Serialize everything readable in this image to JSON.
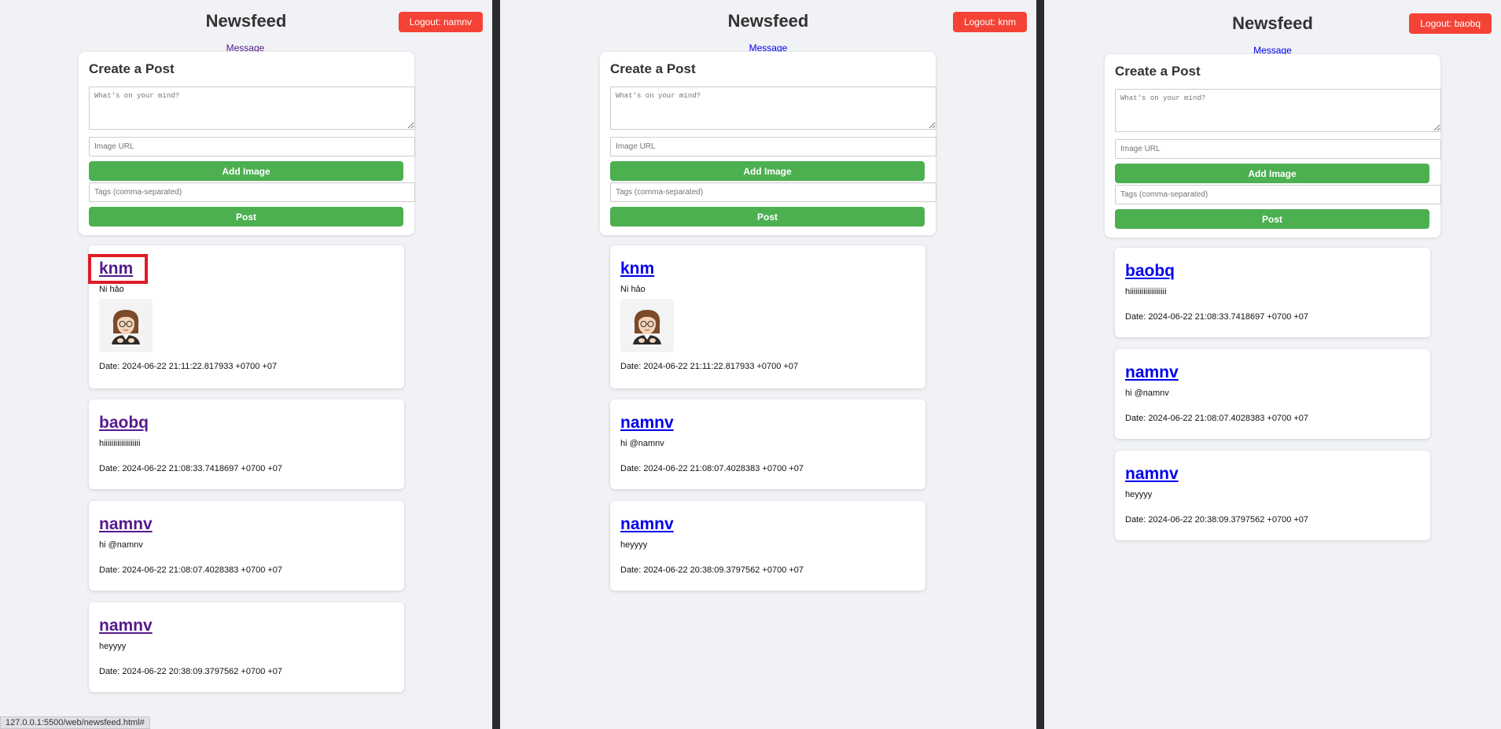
{
  "panes": [
    {
      "title": "Newsfeed",
      "logout_label": "Logout: namnv",
      "message_link": "Message",
      "create": {
        "heading": "Create a Post",
        "content_placeholder": "What's on your mind?",
        "image_placeholder": "Image URL",
        "add_image_label": "Add Image",
        "tags_placeholder": "Tags (comma-separated)",
        "post_label": "Post"
      },
      "posts": [
        {
          "author": "knm",
          "content": "Ni hảo",
          "date": "Date: 2024-06-22 21:11:22.817933 +0700 +07",
          "has_image": true
        },
        {
          "author": "baobq",
          "content": "hiiiiiiiiiiiiiiiiiii",
          "date": "Date: 2024-06-22 21:08:33.7418697 +0700 +07",
          "has_image": false
        },
        {
          "author": "namnv",
          "content": "hi @namnv",
          "date": "Date: 2024-06-22 21:08:07.4028383 +0700 +07",
          "has_image": false
        },
        {
          "author": "namnv",
          "content": "heyyyy",
          "date": "Date: 2024-06-22 20:38:09.3797562 +0700 +07",
          "has_image": false
        }
      ],
      "status_url": "127.0.0.1:5500/web/newsfeed.html#"
    },
    {
      "title": "Newsfeed",
      "logout_label": "Logout: knm",
      "message_link": "Message",
      "create": {
        "heading": "Create a Post",
        "content_placeholder": "What's on your mind?",
        "image_placeholder": "Image URL",
        "add_image_label": "Add Image",
        "tags_placeholder": "Tags (comma-separated)",
        "post_label": "Post"
      },
      "posts": [
        {
          "author": "knm",
          "content": "Ni hảo",
          "date": "Date: 2024-06-22 21:11:22.817933 +0700 +07",
          "has_image": true
        },
        {
          "author": "namnv",
          "content": "hi @namnv",
          "date": "Date: 2024-06-22 21:08:07.4028383 +0700 +07",
          "has_image": false
        },
        {
          "author": "namnv",
          "content": "heyyyy",
          "date": "Date: 2024-06-22 20:38:09.3797562 +0700 +07",
          "has_image": false
        }
      ]
    },
    {
      "title": "Newsfeed",
      "logout_label": "Logout: baobq",
      "message_link": "Message",
      "create": {
        "heading": "Create a Post",
        "content_placeholder": "What's on your mind?",
        "image_placeholder": "Image URL",
        "add_image_label": "Add Image",
        "tags_placeholder": "Tags (comma-separated)",
        "post_label": "Post"
      },
      "posts": [
        {
          "author": "baobq",
          "content": "hiiiiiiiiiiiiiiiiiii",
          "date": "Date: 2024-06-22 21:08:33.7418697 +0700 +07",
          "has_image": false
        },
        {
          "author": "namnv",
          "content": "hi @namnv",
          "date": "Date: 2024-06-22 21:08:07.4028383 +0700 +07",
          "has_image": false
        },
        {
          "author": "namnv",
          "content": "heyyyy",
          "date": "Date: 2024-06-22 20:38:09.3797562 +0700 +07",
          "has_image": false
        }
      ]
    }
  ],
  "colors": {
    "logout": "#f44336",
    "green": "#4caf50",
    "highlight": "#e01b24",
    "link": "#0000ee",
    "visited": "#551a8b"
  }
}
